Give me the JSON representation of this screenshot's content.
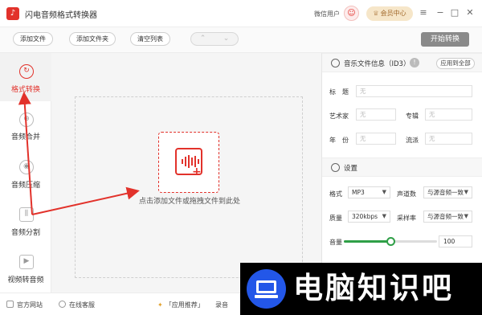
{
  "window": {
    "title": "闪电音频格式转换器",
    "user_label": "微信用户",
    "vip_label": "会员中心",
    "controls": [
      "≡",
      "−",
      "□",
      "✕"
    ]
  },
  "toolbar": {
    "add_file": "添加文件",
    "add_folder": "添加文件夹",
    "clear_list": "清空列表",
    "prev": "⌃",
    "next": "⌄",
    "start": "开始转换"
  },
  "sidebar": {
    "items": [
      {
        "label": "格式转换",
        "icon": "refresh-icon",
        "glyph": "↻"
      },
      {
        "label": "音频合并",
        "icon": "merge-icon",
        "glyph": "⊕"
      },
      {
        "label": "音频压缩",
        "icon": "compress-icon",
        "glyph": "◉"
      },
      {
        "label": "音频分割",
        "icon": "split-icon",
        "glyph": "⫼"
      },
      {
        "label": "视频转音频",
        "icon": "video-icon",
        "glyph": "▶"
      }
    ]
  },
  "dropzone": {
    "text": "点击添加文件或拖拽文件到此处"
  },
  "id3": {
    "title": "音乐文件信息（ID3）",
    "apply_all": "应用到全部",
    "fields": {
      "title_label": "标　题",
      "artist_label": "艺术家",
      "album_label": "专辑",
      "year_label": "年　份",
      "genre_label": "流派",
      "placeholder": "无"
    }
  },
  "settings": {
    "title": "设置",
    "format_label": "格式",
    "format_value": "MP3",
    "channels_label": "声道数",
    "channels_value": "与源音频一致",
    "quality_label": "质量",
    "quality_value": "320kbps",
    "samplerate_label": "采样率",
    "samplerate_value": "与源音频一致",
    "volume_label": "音量",
    "volume_value": "100",
    "volume_fraction": 0.5
  },
  "footer": {
    "website": "官方网站",
    "support": "在线客服",
    "recommend": "「应用推荐」",
    "record": "录音"
  },
  "watermark": {
    "text": "电脑知识吧"
  },
  "colors": {
    "accent": "#e2322b",
    "slider": "#2f9f47",
    "watermark_logo": "#2357e8"
  }
}
